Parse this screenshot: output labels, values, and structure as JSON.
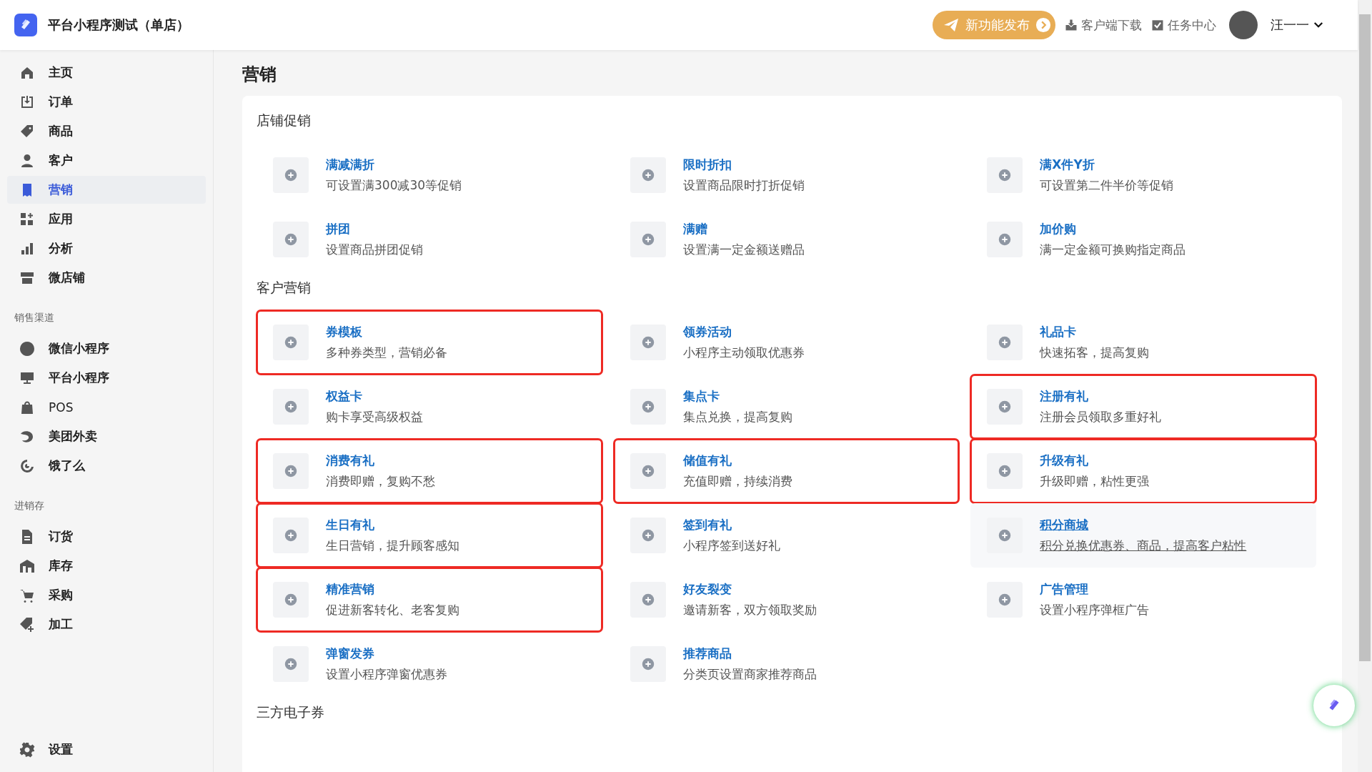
{
  "header": {
    "app_title": "平台小程序测试（单店）",
    "release_button": "新功能发布",
    "links": [
      {
        "kind": "download",
        "label": "客户端下载"
      },
      {
        "kind": "tasks",
        "label": "任务中心"
      }
    ],
    "user": {
      "name": "汪一一"
    }
  },
  "sidebar": {
    "groups": [
      {
        "items": [
          {
            "kind": "home",
            "label": "主页",
            "selected": false
          },
          {
            "kind": "order",
            "label": "订单",
            "selected": false
          },
          {
            "kind": "tag",
            "label": "商品",
            "selected": false
          },
          {
            "kind": "person",
            "label": "客户",
            "selected": false
          },
          {
            "kind": "yen",
            "label": "营销",
            "selected": true
          },
          {
            "kind": "apps",
            "label": "应用",
            "selected": false
          },
          {
            "kind": "chart",
            "label": "分析",
            "selected": false
          },
          {
            "kind": "store",
            "label": "微店铺",
            "selected": false
          }
        ]
      },
      {
        "title": "销售渠道",
        "items": [
          {
            "kind": "mini",
            "label": "微信小程序",
            "selected": false
          },
          {
            "kind": "monitor",
            "label": "平台小程序",
            "selected": false
          },
          {
            "kind": "bag",
            "label": "POS",
            "selected": false
          },
          {
            "kind": "meituan",
            "label": "美团外卖",
            "selected": false
          },
          {
            "kind": "ele",
            "label": "饿了么",
            "selected": false
          }
        ]
      },
      {
        "title": "进销存",
        "items": [
          {
            "kind": "doc",
            "label": "订货",
            "selected": false
          },
          {
            "kind": "warehouse",
            "label": "库存",
            "selected": false
          },
          {
            "kind": "cart",
            "label": "采购",
            "selected": false
          },
          {
            "kind": "tagplus",
            "label": "加工",
            "selected": false
          }
        ]
      }
    ],
    "settings": {
      "label": "设置",
      "selected": false
    }
  },
  "page_title": "营销",
  "sections": [
    {
      "title": "店铺促销",
      "items": [
        {
          "title": "满减满折",
          "desc": "可设置满300减30等促销",
          "highlighted": false,
          "hovered": false
        },
        {
          "title": "限时折扣",
          "desc": "设置商品限时打折促销",
          "highlighted": false,
          "hovered": false
        },
        {
          "title": "满X件Y折",
          "desc": "可设置第二件半价等促销",
          "highlighted": false,
          "hovered": false
        },
        {
          "title": "拼团",
          "desc": "设置商品拼团促销",
          "highlighted": false,
          "hovered": false
        },
        {
          "title": "满赠",
          "desc": "设置满一定金额送赠品",
          "highlighted": false,
          "hovered": false
        },
        {
          "title": "加价购",
          "desc": "满一定金额可换购指定商品",
          "highlighted": false,
          "hovered": false
        }
      ]
    },
    {
      "title": "客户营销",
      "items": [
        {
          "title": "券模板",
          "desc": "多种券类型，营销必备",
          "highlighted": true,
          "hovered": false
        },
        {
          "title": "领券活动",
          "desc": "小程序主动领取优惠券",
          "highlighted": false,
          "hovered": false
        },
        {
          "title": "礼品卡",
          "desc": "快速拓客，提高复购",
          "highlighted": false,
          "hovered": false
        },
        {
          "title": "权益卡",
          "desc": "购卡享受高级权益",
          "highlighted": false,
          "hovered": false
        },
        {
          "title": "集点卡",
          "desc": "集点兑换，提高复购",
          "highlighted": false,
          "hovered": false
        },
        {
          "title": "注册有礼",
          "desc": "注册会员领取多重好礼",
          "highlighted": true,
          "hovered": false
        },
        {
          "title": "消费有礼",
          "desc": "消费即赠，复购不愁",
          "highlighted": true,
          "hovered": false
        },
        {
          "title": "储值有礼",
          "desc": "充值即赠，持续消费",
          "highlighted": true,
          "hovered": false
        },
        {
          "title": "升级有礼",
          "desc": "升级即赠，粘性更强",
          "highlighted": true,
          "hovered": false
        },
        {
          "title": "生日有礼",
          "desc": "生日营销，提升顾客感知",
          "highlighted": true,
          "hovered": false
        },
        {
          "title": "签到有礼",
          "desc": "小程序签到送好礼",
          "highlighted": false,
          "hovered": false
        },
        {
          "title": "积分商城",
          "desc": "积分兑换优惠券、商品，提高客户粘性",
          "highlighted": false,
          "hovered": true
        },
        {
          "title": "精准营销",
          "desc": "促进新客转化、老客复购",
          "highlighted": true,
          "hovered": false
        },
        {
          "title": "好友裂变",
          "desc": "邀请新客，双方领取奖励",
          "highlighted": false,
          "hovered": false
        },
        {
          "title": "广告管理",
          "desc": "设置小程序弹框广告",
          "highlighted": false,
          "hovered": false
        },
        {
          "title": "弹窗发券",
          "desc": "设置小程序弹窗优惠券",
          "highlighted": false,
          "hovered": false
        },
        {
          "title": "推荐商品",
          "desc": "分类页设置商家推荐商品",
          "highlighted": false,
          "hovered": false
        }
      ]
    },
    {
      "title": "三方电子券"
    }
  ]
}
